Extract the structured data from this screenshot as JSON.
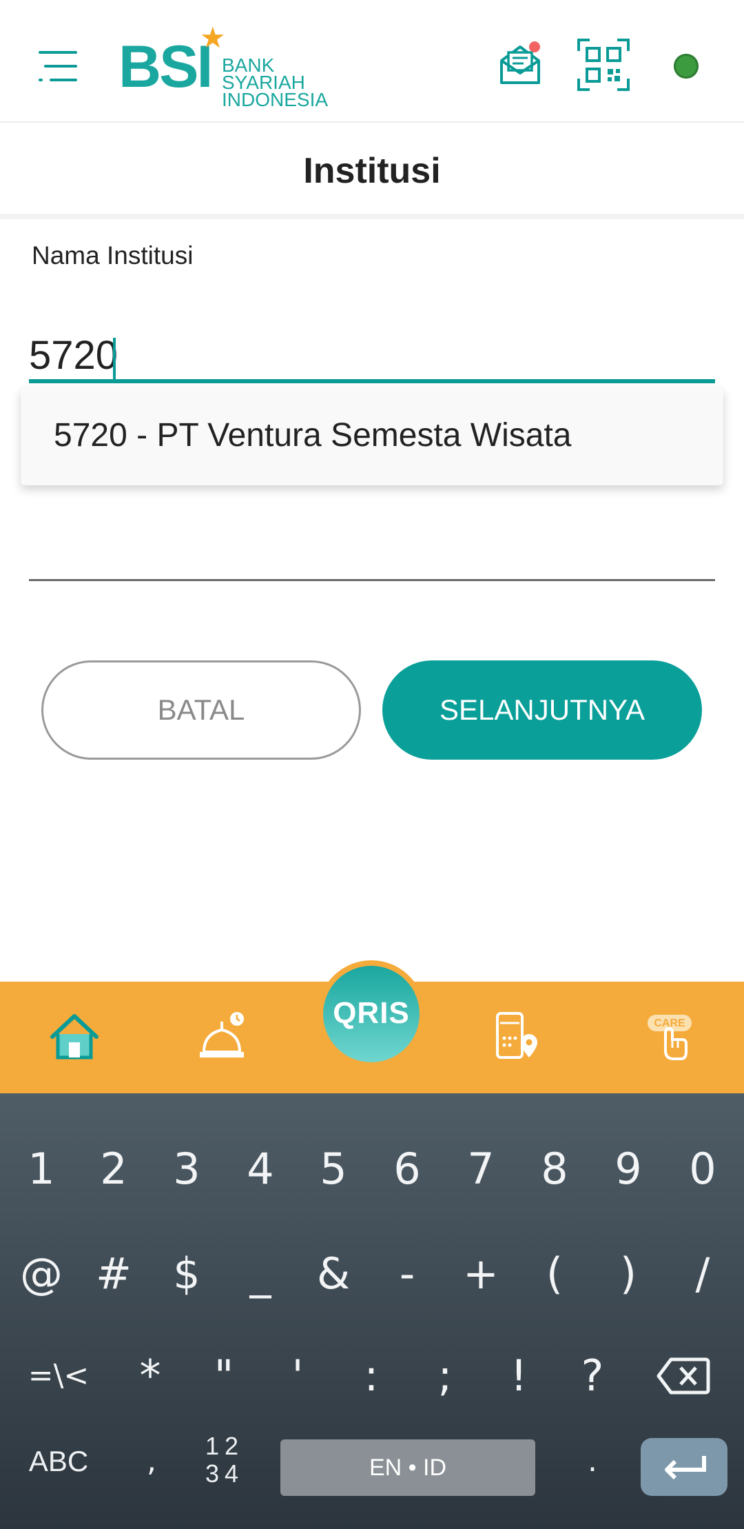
{
  "header": {
    "logo": {
      "brand": "BSI",
      "line1": "BANK SYARIAH",
      "line2": "INDONESIA"
    },
    "icons": {
      "menu": "hamburger-menu-icon",
      "inbox": "mail-notification-icon",
      "qr": "qr-code-icon",
      "status": "online-status-icon"
    },
    "notification_color": "#f26464",
    "status_color": "#3c9a3f"
  },
  "title": "Institusi",
  "form": {
    "label": "Nama Institusi",
    "input_value": "5720",
    "suggestion": "5720 - PT Ventura Semesta Wisata"
  },
  "buttons": {
    "cancel": "BATAL",
    "next": "SELANJUTNYA"
  },
  "bottom_nav": {
    "items": [
      "home-icon",
      "mosque-prayer-icon",
      "qris-icon",
      "mobile-location-icon",
      "care-icon"
    ],
    "qris_label": "QRIS",
    "care_label": "CARE",
    "bg_color": "#f5ab3b",
    "accent_color": "#1aa79f"
  },
  "keyboard": {
    "row1": [
      "1",
      "2",
      "3",
      "4",
      "5",
      "6",
      "7",
      "8",
      "9",
      "0"
    ],
    "row2": [
      "@",
      "#",
      "$",
      "_",
      "&",
      "-",
      "+",
      "(",
      ")",
      "/"
    ],
    "row3": [
      "=\\<",
      "*",
      "\"",
      "'",
      ":",
      ";",
      "!",
      "?"
    ],
    "abc": "ABC",
    "comma": ",",
    "numbers_top": "12",
    "numbers_bottom": "34",
    "space_label": "EN • ID",
    "period": "."
  }
}
